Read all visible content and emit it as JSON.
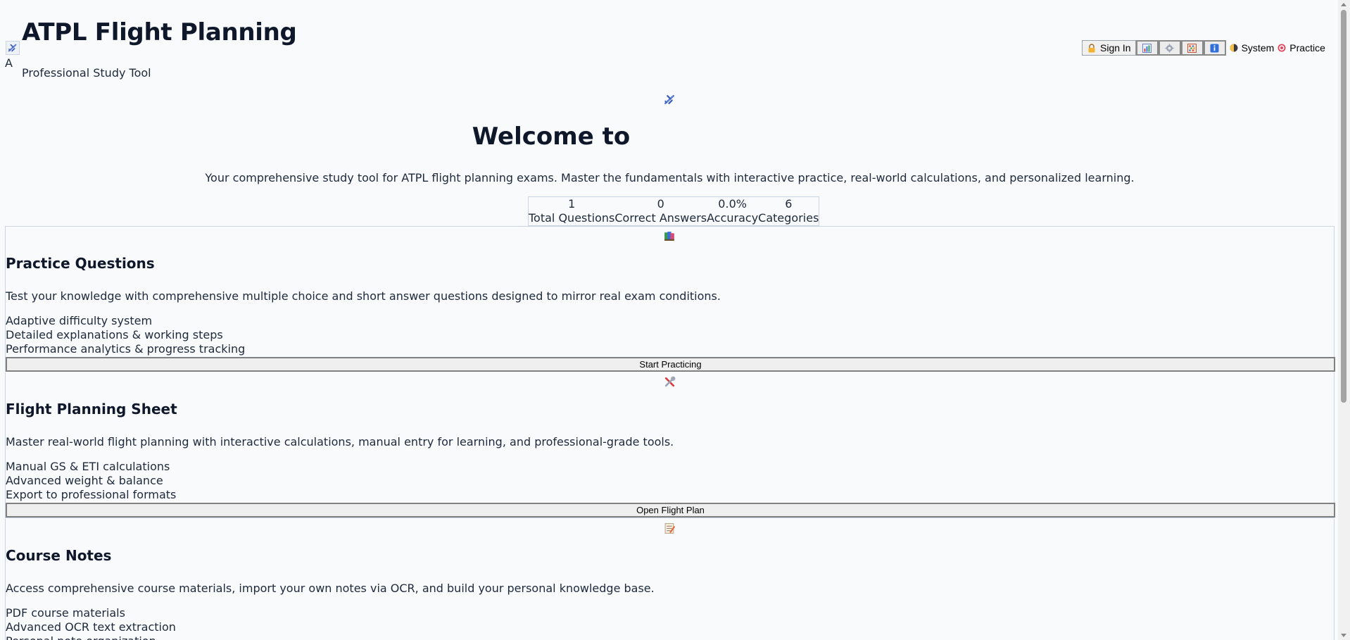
{
  "header": {
    "logo_alt": "A",
    "title": "ATPL Flight Planning",
    "subtitle": "Professional Study Tool"
  },
  "toolbar": {
    "sign_in_label": "Sign In",
    "theme_label": "System",
    "mode_label": "Practice"
  },
  "hero": {
    "title": "Welcome to",
    "description": "Your comprehensive study tool for ATPL flight planning exams. Master the fundamentals with interactive practice, real-world calculations, and personalized learning."
  },
  "stats": [
    {
      "value": "1",
      "label": "Total Questions"
    },
    {
      "value": "0",
      "label": "Correct Answers"
    },
    {
      "value": "0.0%",
      "label": "Accuracy"
    },
    {
      "value": "6",
      "label": "Categories"
    }
  ],
  "cards": [
    {
      "icon": "books-icon",
      "title": "Practice Questions",
      "description": "Test your knowledge with comprehensive multiple choice and short answer questions designed to mirror real exam conditions.",
      "features": [
        "Adaptive difficulty system",
        "Detailed explanations & working steps",
        "Performance analytics & progress tracking"
      ],
      "button_label": "Start Practicing"
    },
    {
      "icon": "tools-icon",
      "title": "Flight Planning Sheet",
      "description": "Master real-world flight planning with interactive calculations, manual entry for learning, and professional-grade tools.",
      "features": [
        "Manual GS & ETI calculations",
        "Advanced weight & balance",
        "Export to professional formats"
      ],
      "button_label": "Open Flight Plan"
    },
    {
      "icon": "notes-icon",
      "title": "Course Notes",
      "description": "Access comprehensive course materials, import your own notes via OCR, and build your personal knowledge base.",
      "features": [
        "PDF course materials",
        "Advanced OCR text extraction",
        "Personal note organization"
      ]
    }
  ],
  "colors": {
    "background": "#f8fafc",
    "heading": "#0f172a",
    "text": "#1e293b",
    "border": "#cbd5e1"
  }
}
